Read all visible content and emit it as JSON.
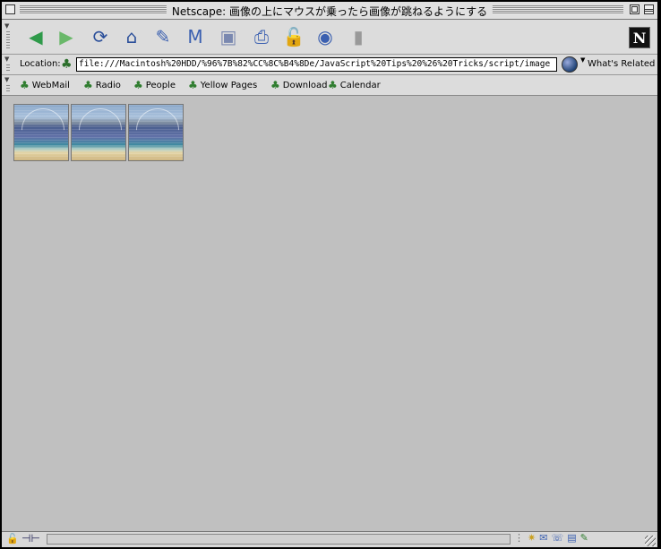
{
  "window": {
    "title": "Netscape: 画像の上にマウスが乗ったら画像が跳ねるようにする"
  },
  "navbar": {
    "buttons": [
      {
        "name": "back-button",
        "icon": "back-arrow-icon",
        "glyph": "◀",
        "color": "#2f9a4a"
      },
      {
        "name": "forward-button",
        "icon": "forward-arrow-icon",
        "glyph": "▶",
        "color": "#6ab86a"
      },
      {
        "name": "reload-button",
        "icon": "reload-icon",
        "glyph": "⟳",
        "color": "#2b4f9a"
      },
      {
        "name": "home-button",
        "icon": "home-icon",
        "glyph": "⌂",
        "color": "#2b4f9a"
      },
      {
        "name": "search-button",
        "icon": "search-icon",
        "glyph": "✎",
        "color": "#3a5fb0"
      },
      {
        "name": "mynetscape-button",
        "icon": "mynetscape-icon",
        "glyph": "M",
        "color": "#3a5fb0"
      },
      {
        "name": "images-button",
        "icon": "images-icon",
        "glyph": "▣",
        "color": "#7a88b0"
      },
      {
        "name": "print-button",
        "icon": "print-icon",
        "glyph": "⎙",
        "color": "#3a5fb0"
      },
      {
        "name": "security-button",
        "icon": "lock-icon",
        "glyph": "🔓",
        "color": "#c02828"
      },
      {
        "name": "shop-button",
        "icon": "shopping-bag-icon",
        "glyph": "◉",
        "color": "#3a5fb0"
      },
      {
        "name": "stop-button",
        "icon": "stop-light-icon",
        "glyph": "▮",
        "color": "#999999"
      }
    ],
    "logo": "N"
  },
  "location": {
    "label": "Location:",
    "url": "file:///Macintosh%20HDD/%96%7B%82%CC%8C%B4%8De/JavaScript%20Tips%20%26%20Tricks/script/image",
    "related_label": "What's Related"
  },
  "personal_toolbar": {
    "items": [
      "WebMail",
      "Radio",
      "People",
      "Yellow Pages",
      "Download",
      "Calendar"
    ]
  },
  "content": {
    "images_count_note": "",
    "background": "#c0c0c0"
  }
}
